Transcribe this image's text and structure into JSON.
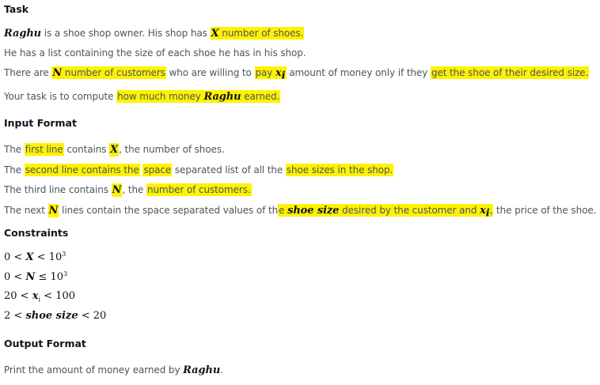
{
  "headings": {
    "task": "Task",
    "input": "Input Format",
    "constraints": "Constraints",
    "output": "Output Format"
  },
  "task": {
    "l1_name": "Raghu",
    "l1_a": " is a shoe shop owner. His shop has ",
    "l1_x": "X",
    "l1_b": " number of shoes.",
    "l2": "He has a list containing the size of each shoe he has in his shop.",
    "l3_a": "There are ",
    "l3_n": "N",
    "l3_b": " number of customers",
    "l3_c": " who are willing to ",
    "l3_d": "pay ",
    "l3_xi": "x",
    "l3_xi_sub": "i",
    "l3_e": " amount of money only if they ",
    "l3_f": "get the shoe of their desired size.",
    "l4_a": "Your task is to compute ",
    "l4_b": "how much money ",
    "l4_name": "Raghu",
    "l4_c": " earned."
  },
  "input": {
    "l1_a": "The ",
    "l1_b": "first line",
    "l1_c": " contains ",
    "l1_x": "X",
    "l1_d": ", the number of shoes.",
    "l2_a": "The ",
    "l2_b": "second line contains the",
    "l2_c": " ",
    "l2_d": "space",
    "l2_e": " separated list of all the ",
    "l2_f": "shoe sizes in the shop.",
    "l3_a": "The third line contains ",
    "l3_n": "N",
    "l3_b": ", the ",
    "l3_c": "number of customers.",
    "l4_a": "The next ",
    "l4_n": "N",
    "l4_b": " lines contain the space separated values of th",
    "l4_c": "e ",
    "l4_size": "shoe size",
    "l4_d": " desired by the customer and ",
    "l4_xi": "x",
    "l4_xi_sub": "i",
    "l4_e": ",",
    "l4_f": " the price of the shoe."
  },
  "constraints": {
    "c1_a": "0 < ",
    "c1_var": "X",
    "c1_b": " < 10",
    "c1_exp": "3",
    "c2_a": "0 < ",
    "c2_var": "N",
    "c2_b": " ≤ 10",
    "c2_exp": "3",
    "c3_a": "20 < ",
    "c3_var": "x",
    "c3_sub": "i",
    "c3_b": " < 100",
    "c4_a": "2 < ",
    "c4_var": "shoe size",
    "c4_b": " < 20"
  },
  "output": {
    "text": "Print the amount of money earned by ",
    "name": "Raghu",
    "end": "."
  }
}
